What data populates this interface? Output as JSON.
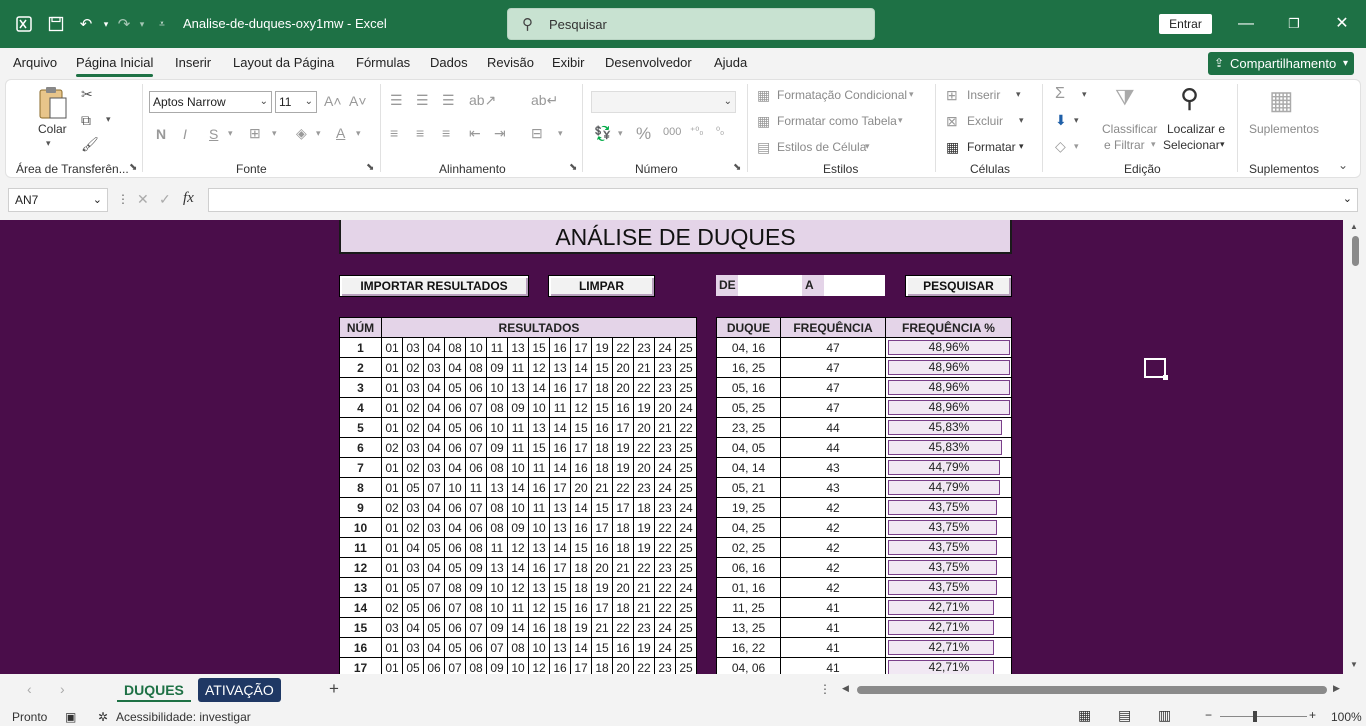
{
  "titlebar": {
    "doc_title": "Analise-de-duques-oxy1mw  -  Excel",
    "search_placeholder": "Pesquisar",
    "signin": "Entrar"
  },
  "menu": {
    "tabs": [
      "Arquivo",
      "Página Inicial",
      "Inserir",
      "Layout da Página",
      "Fórmulas",
      "Dados",
      "Revisão",
      "Exibir",
      "Desenvolvedor",
      "Ajuda"
    ],
    "share": "Compartilhamento"
  },
  "ribbon": {
    "clipboard": {
      "paste": "Colar",
      "label": "Área de Transferên..."
    },
    "font": {
      "name": "Aptos Narrow",
      "size": "11",
      "label": "Fonte",
      "bold": "N",
      "italic": "I",
      "underline": "S"
    },
    "alignment": {
      "label": "Alinhamento"
    },
    "number": {
      "label": "Número"
    },
    "styles": {
      "cond": "Formatação Condicional",
      "table": "Formatar como Tabela",
      "cell": "Estilos de Célula",
      "label": "Estilos"
    },
    "cells": {
      "insert": "Inserir",
      "delete": "Excluir",
      "format": "Formatar",
      "label": "Células"
    },
    "editing": {
      "sort1": "Classificar",
      "sort2": "e Filtrar",
      "find1": "Localizar e",
      "find2": "Selecionar",
      "label": "Edição"
    },
    "addins": {
      "btn": "Suplementos",
      "label": "Suplementos"
    }
  },
  "formula_bar": {
    "name_box": "AN7",
    "formula": ""
  },
  "sheet": {
    "title": "ANÁLISE DE DUQUES",
    "buttons": {
      "import": "IMPORTAR RESULTADOS",
      "clear": "LIMPAR",
      "search": "PESQUISAR"
    },
    "de_label": "DE",
    "a_label": "A",
    "results_headers": [
      "NÚM",
      "RESULTADOS"
    ],
    "results": [
      {
        "n": "1",
        "v": [
          "01",
          "03",
          "04",
          "08",
          "10",
          "11",
          "13",
          "15",
          "16",
          "17",
          "19",
          "22",
          "23",
          "24",
          "25"
        ]
      },
      {
        "n": "2",
        "v": [
          "01",
          "02",
          "03",
          "04",
          "08",
          "09",
          "11",
          "12",
          "13",
          "14",
          "15",
          "20",
          "21",
          "23",
          "25"
        ]
      },
      {
        "n": "3",
        "v": [
          "01",
          "03",
          "04",
          "05",
          "06",
          "10",
          "13",
          "14",
          "16",
          "17",
          "18",
          "20",
          "22",
          "23",
          "25"
        ]
      },
      {
        "n": "4",
        "v": [
          "01",
          "02",
          "04",
          "06",
          "07",
          "08",
          "09",
          "10",
          "11",
          "12",
          "15",
          "16",
          "19",
          "20",
          "24"
        ]
      },
      {
        "n": "5",
        "v": [
          "01",
          "02",
          "04",
          "05",
          "06",
          "10",
          "11",
          "13",
          "14",
          "15",
          "16",
          "17",
          "20",
          "21",
          "22"
        ]
      },
      {
        "n": "6",
        "v": [
          "02",
          "03",
          "04",
          "06",
          "07",
          "09",
          "11",
          "15",
          "16",
          "17",
          "18",
          "19",
          "22",
          "23",
          "25"
        ]
      },
      {
        "n": "7",
        "v": [
          "01",
          "02",
          "03",
          "04",
          "06",
          "08",
          "10",
          "11",
          "14",
          "16",
          "18",
          "19",
          "20",
          "24",
          "25"
        ]
      },
      {
        "n": "8",
        "v": [
          "01",
          "05",
          "07",
          "10",
          "11",
          "13",
          "14",
          "16",
          "17",
          "20",
          "21",
          "22",
          "23",
          "24",
          "25"
        ]
      },
      {
        "n": "9",
        "v": [
          "02",
          "03",
          "04",
          "06",
          "07",
          "08",
          "10",
          "11",
          "13",
          "14",
          "15",
          "17",
          "18",
          "23",
          "24"
        ]
      },
      {
        "n": "10",
        "v": [
          "01",
          "02",
          "03",
          "04",
          "06",
          "08",
          "09",
          "10",
          "13",
          "16",
          "17",
          "18",
          "19",
          "22",
          "24"
        ]
      },
      {
        "n": "11",
        "v": [
          "01",
          "04",
          "05",
          "06",
          "08",
          "11",
          "12",
          "13",
          "14",
          "15",
          "16",
          "18",
          "19",
          "22",
          "25"
        ]
      },
      {
        "n": "12",
        "v": [
          "01",
          "03",
          "04",
          "05",
          "09",
          "13",
          "14",
          "16",
          "17",
          "18",
          "20",
          "21",
          "22",
          "23",
          "25"
        ]
      },
      {
        "n": "13",
        "v": [
          "01",
          "05",
          "07",
          "08",
          "09",
          "10",
          "12",
          "13",
          "15",
          "18",
          "19",
          "20",
          "21",
          "22",
          "24"
        ]
      },
      {
        "n": "14",
        "v": [
          "02",
          "05",
          "06",
          "07",
          "08",
          "10",
          "11",
          "12",
          "15",
          "16",
          "17",
          "18",
          "21",
          "22",
          "25"
        ]
      },
      {
        "n": "15",
        "v": [
          "03",
          "04",
          "05",
          "06",
          "07",
          "09",
          "14",
          "16",
          "18",
          "19",
          "21",
          "22",
          "23",
          "24",
          "25"
        ]
      },
      {
        "n": "16",
        "v": [
          "01",
          "03",
          "04",
          "05",
          "06",
          "07",
          "08",
          "10",
          "13",
          "14",
          "15",
          "16",
          "19",
          "24",
          "25"
        ]
      },
      {
        "n": "17",
        "v": [
          "01",
          "05",
          "06",
          "07",
          "08",
          "09",
          "10",
          "12",
          "16",
          "17",
          "18",
          "20",
          "22",
          "23",
          "25"
        ]
      }
    ],
    "freq_headers": [
      "DUQUE",
      "FREQUÊNCIA",
      "FREQUÊNCIA %"
    ],
    "freq": [
      {
        "d": "04, 16",
        "f": "47",
        "p": "48,96%",
        "pv": 48.96
      },
      {
        "d": "16, 25",
        "f": "47",
        "p": "48,96%",
        "pv": 48.96
      },
      {
        "d": "05, 16",
        "f": "47",
        "p": "48,96%",
        "pv": 48.96
      },
      {
        "d": "05, 25",
        "f": "47",
        "p": "48,96%",
        "pv": 48.96
      },
      {
        "d": "23, 25",
        "f": "44",
        "p": "45,83%",
        "pv": 45.83
      },
      {
        "d": "04, 05",
        "f": "44",
        "p": "45,83%",
        "pv": 45.83
      },
      {
        "d": "04, 14",
        "f": "43",
        "p": "44,79%",
        "pv": 44.79
      },
      {
        "d": "05, 21",
        "f": "43",
        "p": "44,79%",
        "pv": 44.79
      },
      {
        "d": "19, 25",
        "f": "42",
        "p": "43,75%",
        "pv": 43.75
      },
      {
        "d": "04, 25",
        "f": "42",
        "p": "43,75%",
        "pv": 43.75
      },
      {
        "d": "02, 25",
        "f": "42",
        "p": "43,75%",
        "pv": 43.75
      },
      {
        "d": "06, 16",
        "f": "42",
        "p": "43,75%",
        "pv": 43.75
      },
      {
        "d": "01, 16",
        "f": "42",
        "p": "43,75%",
        "pv": 43.75
      },
      {
        "d": "11, 25",
        "f": "41",
        "p": "42,71%",
        "pv": 42.71
      },
      {
        "d": "13, 25",
        "f": "41",
        "p": "42,71%",
        "pv": 42.71
      },
      {
        "d": "16, 22",
        "f": "41",
        "p": "42,71%",
        "pv": 42.71
      },
      {
        "d": "04, 06",
        "f": "41",
        "p": "42,71%",
        "pv": 42.71
      }
    ]
  },
  "sheet_tabs": [
    "DUQUES",
    "ATIVAÇÃO"
  ],
  "status": {
    "ready": "Pronto",
    "accessibility": "Acessibilidade: investigar",
    "zoom": "100%"
  },
  "colors": {
    "excel_green": "#1e7145",
    "sheet_bg": "#4a0d4a",
    "header_fill": "#e4d4e8",
    "tab_blue": "#1f3864"
  }
}
